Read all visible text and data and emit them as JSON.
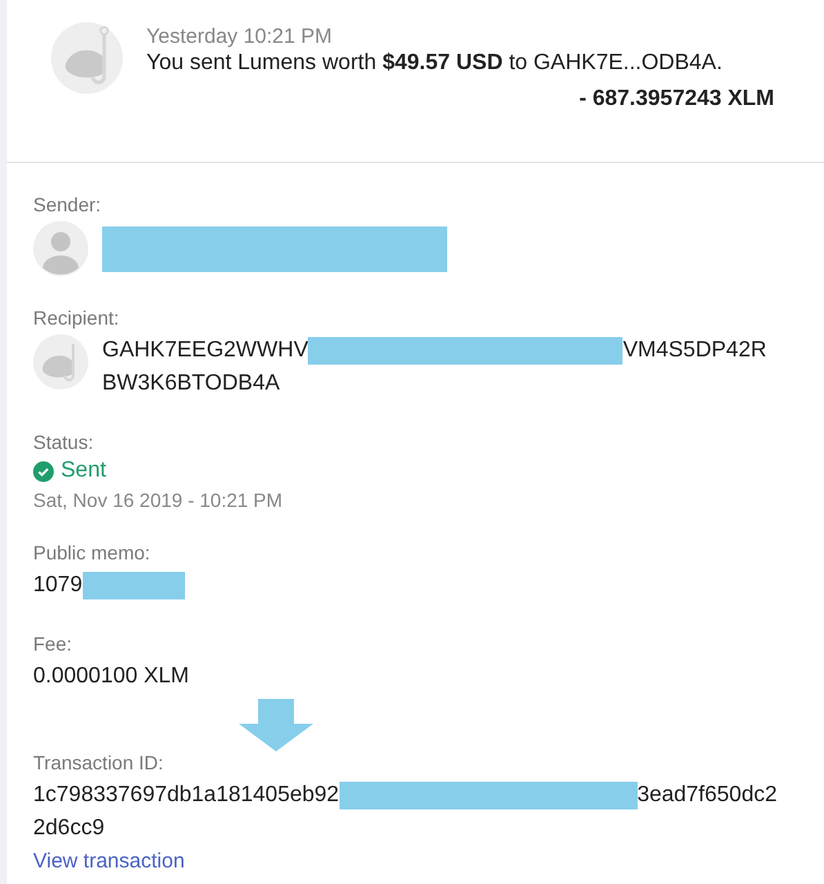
{
  "header": {
    "time": "Yesterday 10:21 PM",
    "message": "You sent Lumens worth **$49.57 USD** to GAHK7E...ODB4A.",
    "amount": "- 687.3957243 XLM"
  },
  "fields": [
    {
      "kind": "sender",
      "label": "Sender:"
    },
    {
      "kind": "recipient",
      "label": "Recipient:",
      "parts": [
        "GAHK7EEG2WWHV",
        "VM4S5DP42R"
      ],
      "line2": "BW3K6BTODB4A"
    },
    {
      "kind": "status",
      "label": "Status:",
      "status": "Sent",
      "date": "Sat, Nov 16 2019 - 10:21 PM"
    },
    {
      "kind": "memo",
      "label": "Public memo:",
      "parts": [
        "1079"
      ]
    },
    {
      "kind": "plain",
      "label": "Fee:",
      "value": "0.0000100 XLM"
    },
    {
      "kind": "txid",
      "label": "Transaction ID:",
      "parts": [
        "1c798337697db1a181405eb92",
        "3ead7f650dc2"
      ],
      "line2": "2d6cc9",
      "link": "View transaction"
    }
  ]
}
